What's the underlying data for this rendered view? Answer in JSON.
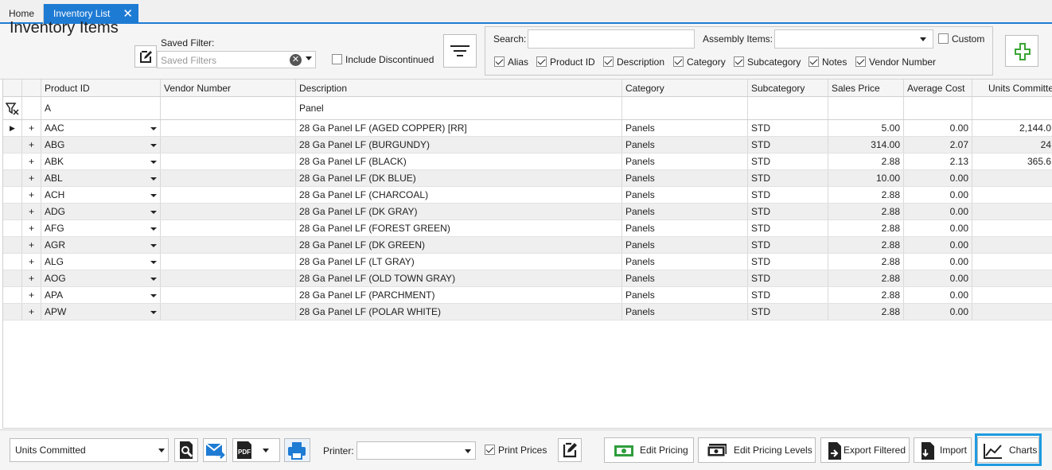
{
  "tabs": [
    {
      "label": "Home"
    },
    {
      "label": "Inventory List",
      "close": "✕"
    }
  ],
  "toolbar": {
    "title": "Inventory Items",
    "saved_filter_label": "Saved Filter:",
    "saved_filter_placeholder": "Saved Filters",
    "include_discontinued": "Include Discontinued",
    "include_discontinued_checked": false
  },
  "search": {
    "label": "Search:",
    "value": "",
    "assembly_label": "Assembly Items:",
    "assembly_value": "",
    "custom_label": "Custom",
    "custom_checked": false,
    "options": [
      {
        "label": "Alias",
        "checked": true
      },
      {
        "label": "Product ID",
        "checked": true
      },
      {
        "label": "Description",
        "checked": true
      },
      {
        "label": "Category",
        "checked": true
      },
      {
        "label": "Subcategory",
        "checked": true
      },
      {
        "label": "Notes",
        "checked": true
      },
      {
        "label": "Vendor Number",
        "checked": true
      }
    ]
  },
  "grid": {
    "columns": [
      "Product ID",
      "Vendor Number",
      "Description",
      "Category",
      "Subcategory",
      "Sales Price",
      "Average Cost",
      "Units Committe"
    ],
    "filter_row": {
      "product_id": "A",
      "description": "Panel"
    },
    "rows": [
      {
        "id": "AAC",
        "vendor": "",
        "desc": "28 Ga Panel LF (AGED COPPER) [RR]",
        "cat": "Panels",
        "sub": "STD",
        "price": "5.00",
        "cost": "0.00",
        "units": "2,144.0"
      },
      {
        "id": "ABG",
        "vendor": "",
        "desc": "28 Ga Panel LF (BURGUNDY)",
        "cat": "Panels",
        "sub": "STD",
        "price": "314.00",
        "cost": "2.07",
        "units": "24"
      },
      {
        "id": "ABK",
        "vendor": "",
        "desc": "28 Ga Panel LF (BLACK)",
        "cat": "Panels",
        "sub": "STD",
        "price": "2.88",
        "cost": "2.13",
        "units": "365.6"
      },
      {
        "id": "ABL",
        "vendor": "",
        "desc": "28 Ga Panel LF (DK BLUE)",
        "cat": "Panels",
        "sub": "STD",
        "price": "10.00",
        "cost": "0.00",
        "units": ""
      },
      {
        "id": "ACH",
        "vendor": "",
        "desc": "28 Ga Panel LF (CHARCOAL)",
        "cat": "Panels",
        "sub": "STD",
        "price": "2.88",
        "cost": "0.00",
        "units": ""
      },
      {
        "id": "ADG",
        "vendor": "",
        "desc": "28 Ga Panel LF (DK GRAY)",
        "cat": "Panels",
        "sub": "STD",
        "price": "2.88",
        "cost": "0.00",
        "units": ""
      },
      {
        "id": "AFG",
        "vendor": "",
        "desc": "28 Ga Panel LF (FOREST GREEN)",
        "cat": "Panels",
        "sub": "STD",
        "price": "2.88",
        "cost": "0.00",
        "units": ""
      },
      {
        "id": "AGR",
        "vendor": "",
        "desc": "28 Ga Panel LF (DK GREEN)",
        "cat": "Panels",
        "sub": "STD",
        "price": "2.88",
        "cost": "0.00",
        "units": ""
      },
      {
        "id": "ALG",
        "vendor": "",
        "desc": "28 Ga Panel LF (LT GRAY)",
        "cat": "Panels",
        "sub": "STD",
        "price": "2.88",
        "cost": "0.00",
        "units": ""
      },
      {
        "id": "AOG",
        "vendor": "",
        "desc": "28 Ga Panel LF (OLD TOWN GRAY)",
        "cat": "Panels",
        "sub": "STD",
        "price": "2.88",
        "cost": "0.00",
        "units": ""
      },
      {
        "id": "APA",
        "vendor": "",
        "desc": "28 Ga Panel LF (PARCHMENT)",
        "cat": "Panels",
        "sub": "STD",
        "price": "2.88",
        "cost": "0.00",
        "units": ""
      },
      {
        "id": "APW",
        "vendor": "",
        "desc": "28 Ga Panel LF (POLAR WHITE)",
        "cat": "Panels",
        "sub": "STD",
        "price": "2.88",
        "cost": "0.00",
        "units": ""
      }
    ],
    "selected_row": 0
  },
  "bottom": {
    "report_value": "Units Committed",
    "printer_label": "Printer:",
    "printer_value": "",
    "print_prices_label": "Print Prices",
    "print_prices_checked": true,
    "buttons": {
      "edit_pricing": "Edit Pricing",
      "edit_pricing_levels": "Edit Pricing Levels",
      "export_filtered": "Export Filtered",
      "import": "Import",
      "charts": "Charts"
    }
  },
  "colors": {
    "accent": "#1e7bd4",
    "highlight": "#1e9be0",
    "add_green": "#3aa535",
    "money_green": "#2e9e3c"
  }
}
